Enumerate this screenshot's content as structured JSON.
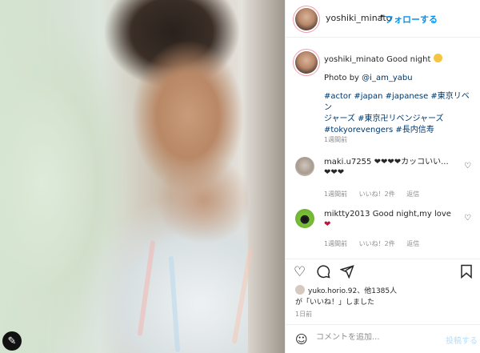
{
  "post": {
    "username": "yoshiki_minato",
    "follow_label": "フォローする",
    "dot": "•",
    "more_glyph": "•••",
    "caption": {
      "username": "yoshiki_minato",
      "text": "Good night",
      "photo_by": "Photo by",
      "photo_by_handle": "@i_am_yabu",
      "hashtags_line1": "#actor #japan #japanese #東京リベン",
      "hashtags_line2": "ジャーズ #東京卍リベンジャーズ",
      "hashtags_line3": "#tokyorevengers #長内信寿",
      "timestamp": "1週間前"
    },
    "comments": [
      {
        "username": "maki.u7255",
        "text": "❤❤❤❤カッコいい...",
        "text2": "❤❤❤",
        "time": "1週間前",
        "likes": "いいね！2件",
        "reply": "返信"
      },
      {
        "username": "miktty2013",
        "text": "Good night,my love",
        "text2": "❤",
        "time": "1週間前",
        "likes": "いいね！2件",
        "reply": "返信"
      }
    ],
    "likes": {
      "liker": "yuko.horio.92",
      "others": "他1385人",
      "suffix": "が「いいね！」しました"
    },
    "date": "1日前",
    "comment_placeholder": "コメントを追加...",
    "post_label": "投稿する"
  },
  "icons": {
    "heart": "heart-icon",
    "comment": "comment-icon",
    "share": "share-icon",
    "bookmark": "bookmark-icon",
    "emoji": "emoji-icon"
  },
  "colors": {
    "accent_blue": "#0095f6",
    "post_disabled": "#b2dffc",
    "muted": "#8e8e8e"
  }
}
